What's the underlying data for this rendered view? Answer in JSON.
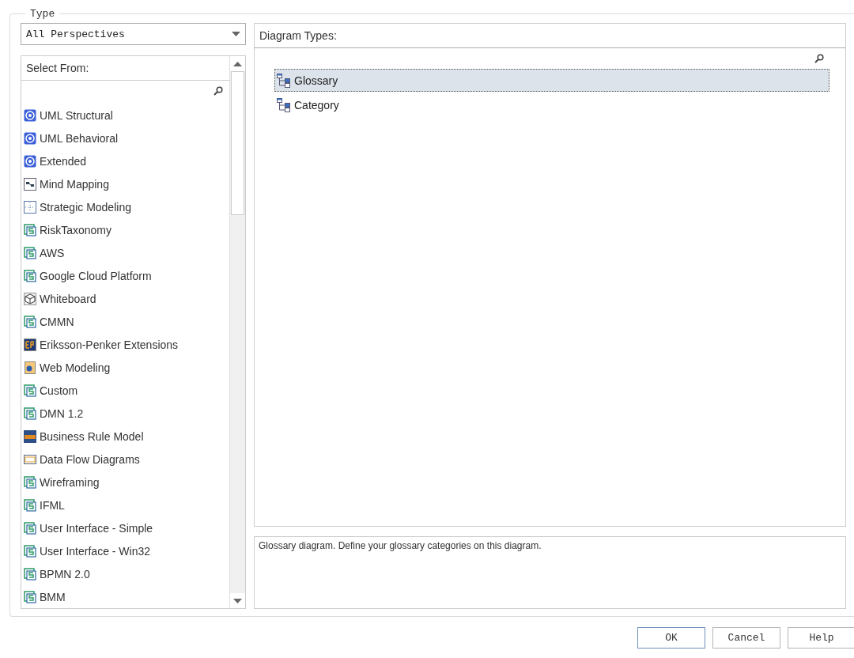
{
  "group": {
    "legend": "Type"
  },
  "perspective": {
    "value": "All Perspectives"
  },
  "select_from": {
    "header": "Select From:",
    "items": [
      {
        "label": "UML Structural",
        "kind": "uml"
      },
      {
        "label": "UML Behavioral",
        "kind": "uml"
      },
      {
        "label": "Extended",
        "kind": "uml"
      },
      {
        "label": "Mind Mapping",
        "kind": "mind"
      },
      {
        "label": "Strategic Modeling",
        "kind": "strategic"
      },
      {
        "label": "RiskTaxonomy",
        "kind": "mdg"
      },
      {
        "label": "AWS",
        "kind": "mdg"
      },
      {
        "label": "Google Cloud Platform",
        "kind": "mdg"
      },
      {
        "label": "Whiteboard",
        "kind": "cube"
      },
      {
        "label": "CMMN",
        "kind": "mdg"
      },
      {
        "label": "Eriksson-Penker Extensions",
        "kind": "ep"
      },
      {
        "label": "Web Modeling",
        "kind": "web"
      },
      {
        "label": "Custom",
        "kind": "mdg"
      },
      {
        "label": "DMN 1.2",
        "kind": "mdg"
      },
      {
        "label": "Business Rule Model",
        "kind": "brm"
      },
      {
        "label": "Data Flow Diagrams",
        "kind": "dfd"
      },
      {
        "label": "Wireframing",
        "kind": "mdg"
      },
      {
        "label": "IFML",
        "kind": "mdg"
      },
      {
        "label": "User Interface - Simple",
        "kind": "mdg"
      },
      {
        "label": "User Interface - Win32",
        "kind": "mdg"
      },
      {
        "label": "BPMN 2.0",
        "kind": "mdg"
      },
      {
        "label": "BMM",
        "kind": "mdg"
      }
    ]
  },
  "diagram_types": {
    "header": "Diagram Types:",
    "items": [
      {
        "label": "Glossary",
        "selected": true
      },
      {
        "label": "Category",
        "selected": false
      }
    ]
  },
  "description": "Glossary diagram. Define your glossary categories on this diagram.",
  "buttons": [
    {
      "label": "OK",
      "default": true
    },
    {
      "label": "Cancel",
      "default": false
    },
    {
      "label": "Help",
      "default": false
    }
  ]
}
